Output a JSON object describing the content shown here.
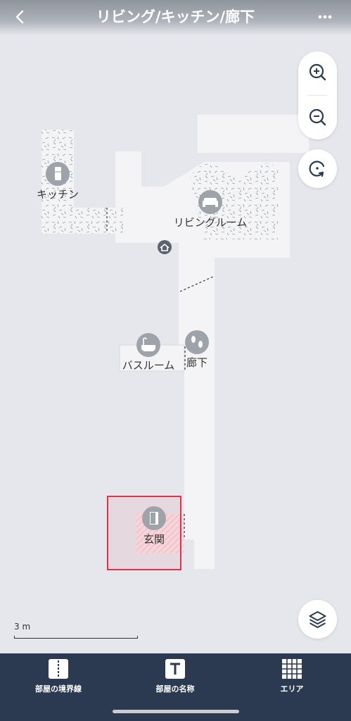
{
  "header": {
    "title": "リビング/キッチン/廊下"
  },
  "map": {
    "rooms": [
      {
        "name": "キッチン",
        "icon": "fridge-icon"
      },
      {
        "name": "リビングルーム",
        "icon": "sofa-icon"
      },
      {
        "name": "バスルーム",
        "icon": "bathtub-icon"
      },
      {
        "name": "廊下",
        "icon": "footprints-icon"
      },
      {
        "name": "玄関",
        "icon": "door-icon"
      }
    ],
    "dock_icon": "home-icon",
    "selection_color": "#e0304a"
  },
  "controls": {
    "zoom_in_icon": "zoom-in-icon",
    "zoom_out_icon": "zoom-out-icon",
    "rotate_icon": "rotate-icon",
    "layers_icon": "layers-icon"
  },
  "scale": {
    "label": "3 m"
  },
  "toolbar": {
    "items": [
      {
        "label": "部屋の境界線",
        "icon": "divider-icon"
      },
      {
        "label": "部屋の名称",
        "icon": "text-icon"
      },
      {
        "label": "エリア",
        "icon": "grid-icon"
      }
    ]
  },
  "colors": {
    "toolbar_bg": "#2b3a50",
    "map_bg": "#e6e7ec",
    "floor": "#f4f4f6"
  }
}
